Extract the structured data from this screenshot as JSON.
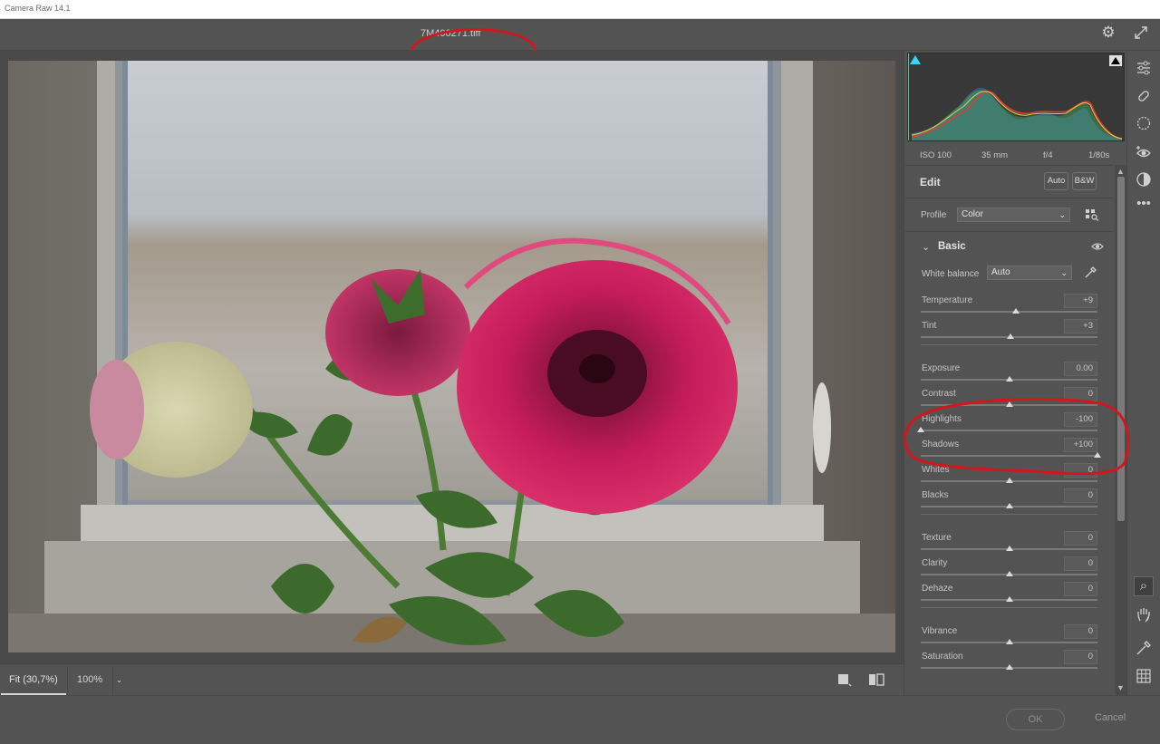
{
  "window": {
    "title": "Camera Raw 14.1"
  },
  "document": {
    "filename": "7M400271.tiff"
  },
  "exif": {
    "iso": "ISO 100",
    "focal": "35 mm",
    "aperture": "f/4",
    "shutter": "1/80s"
  },
  "edit": {
    "title": "Edit",
    "auto_label": "Auto",
    "bw_label": "B&W",
    "profile_label": "Profile",
    "profile_value": "Color",
    "section_title": "Basic",
    "white_balance_label": "White balance",
    "white_balance_value": "Auto"
  },
  "sliders": [
    {
      "label": "Temperature",
      "value": "+9",
      "level": 0.54
    },
    {
      "label": "Tint",
      "value": "+3",
      "level": 0.51
    },
    {
      "label": "Exposure",
      "value": "0.00",
      "level": 0.5
    },
    {
      "label": "Contrast",
      "value": "0",
      "level": 0.5
    },
    {
      "label": "Highlights",
      "value": "-100",
      "level": 0.0
    },
    {
      "label": "Shadows",
      "value": "+100",
      "level": 1.0
    },
    {
      "label": "Whites",
      "value": "0",
      "level": 0.5
    },
    {
      "label": "Blacks",
      "value": "0",
      "level": 0.5
    },
    {
      "label": "Texture",
      "value": "0",
      "level": 0.5
    },
    {
      "label": "Clarity",
      "value": "0",
      "level": 0.5
    },
    {
      "label": "Dehaze",
      "value": "0",
      "level": 0.5
    },
    {
      "label": "Vibrance",
      "value": "0",
      "level": 0.5
    },
    {
      "label": "Saturation",
      "value": "0",
      "level": 0.5
    }
  ],
  "bottom": {
    "fit_label": "Fit (30,7%)",
    "zoom_value": "100%"
  },
  "footer": {
    "ok_label": "OK",
    "cancel_label": "Cancel"
  },
  "icons": {
    "settings": "gear-icon",
    "fullscreen": "expand-icon",
    "tools": [
      "edit-sliders-icon",
      "healing-icon",
      "masking-icon",
      "red-eye-icon",
      "presets-icon",
      "more-icon",
      "zoom-icon",
      "hand-icon",
      "color-sampler-icon",
      "grid-icon"
    ]
  },
  "colors": {
    "panel_bg": "#535353",
    "annotation": "#d4161c"
  }
}
